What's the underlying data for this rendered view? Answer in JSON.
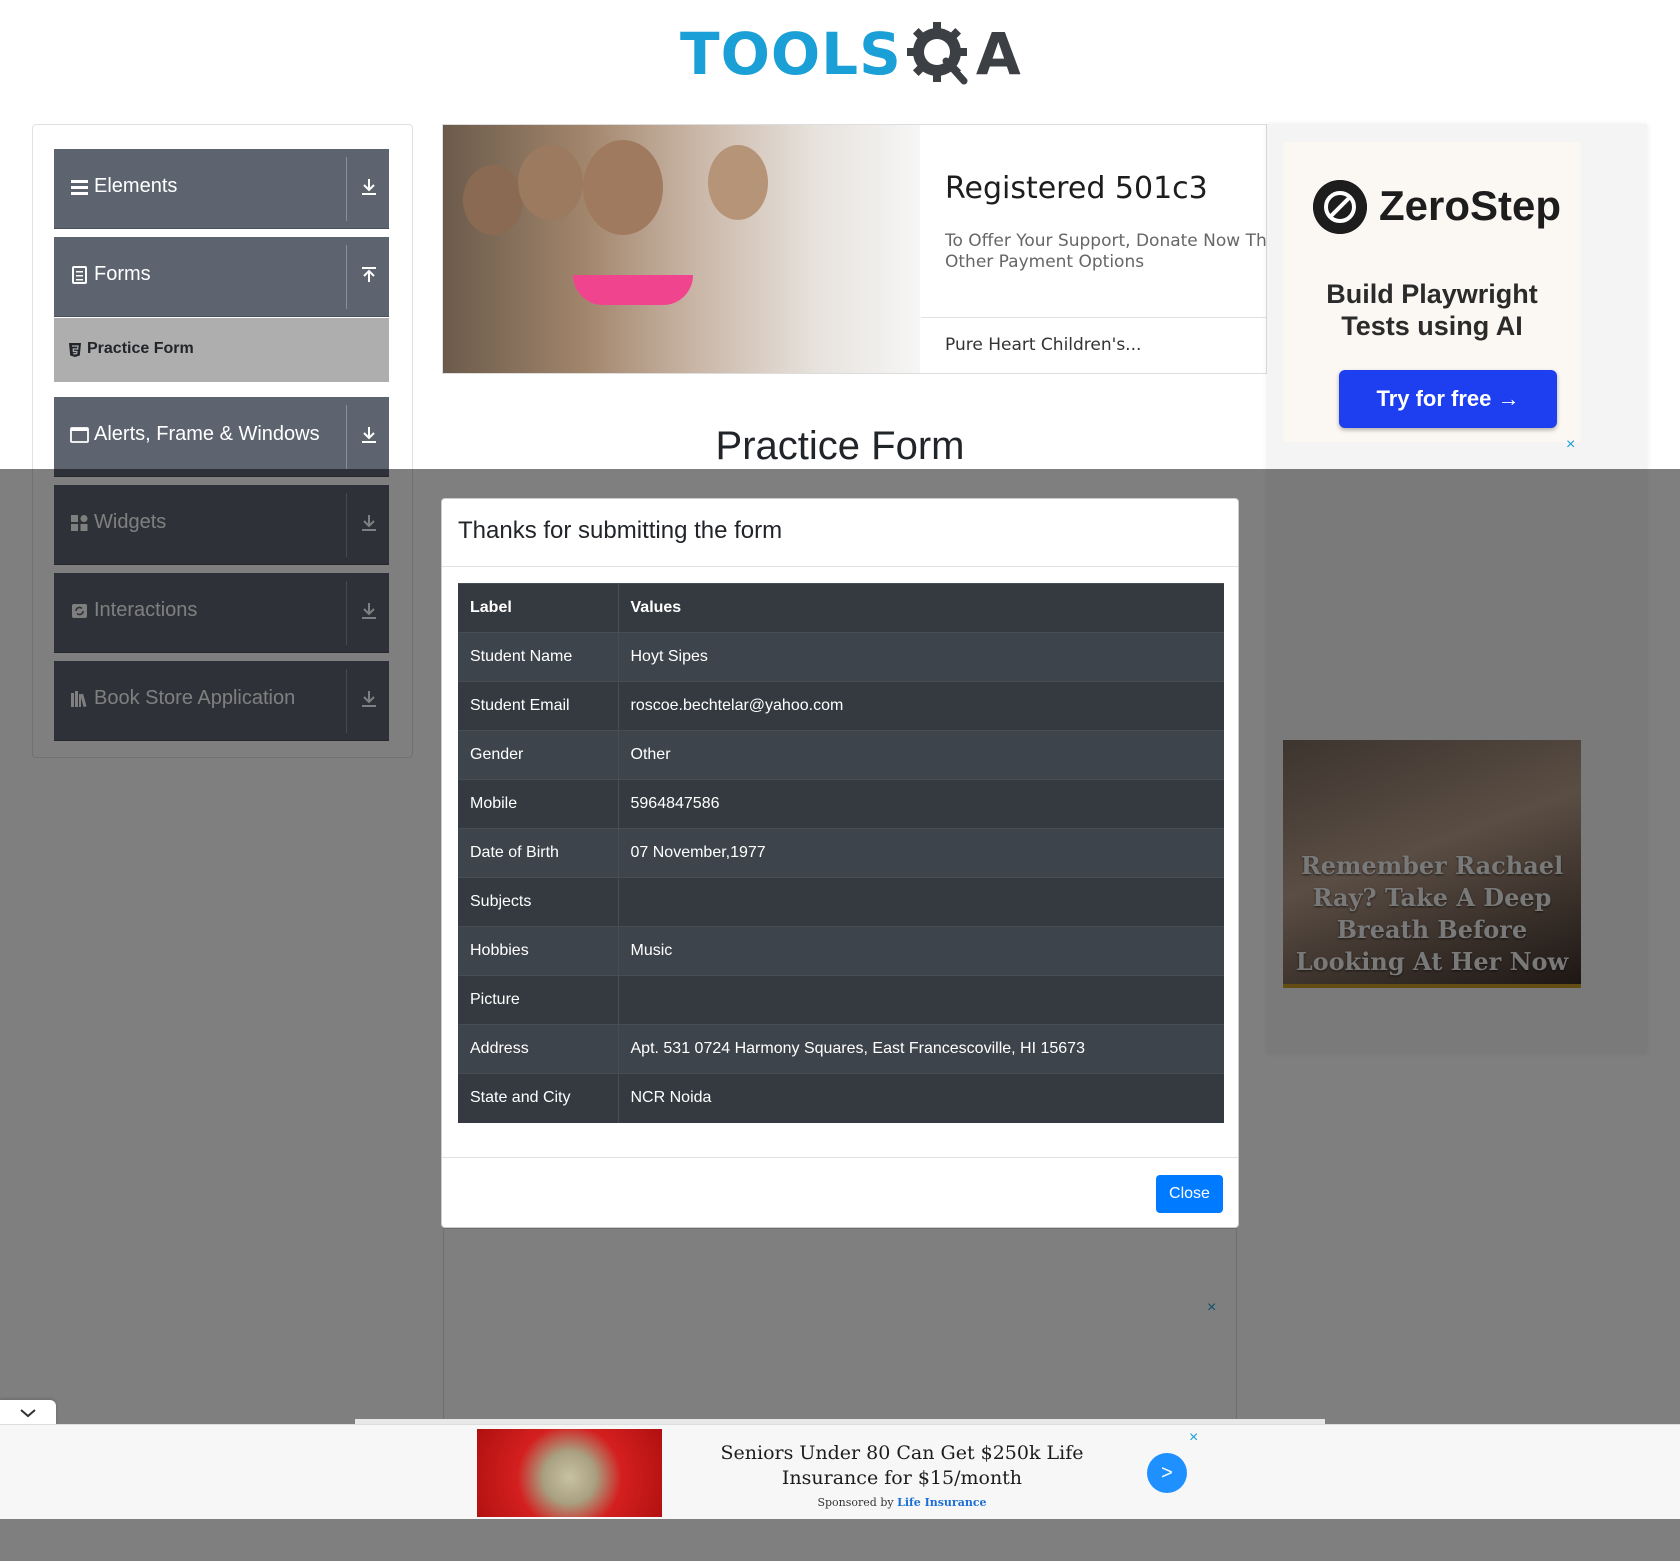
{
  "header": {
    "logo_tools": "TOOLS",
    "logo_a": "A"
  },
  "sidebar": {
    "groups": [
      {
        "label": "Elements",
        "icon": "menu-icon",
        "expanded": false
      },
      {
        "label": "Forms",
        "icon": "form-icon",
        "expanded": true
      },
      {
        "label": "Alerts, Frame & Windows",
        "icon": "window-icon",
        "expanded": false
      },
      {
        "label": "Widgets",
        "icon": "widgets-icon",
        "expanded": false
      },
      {
        "label": "Interactions",
        "icon": "interactions-icon",
        "expanded": false
      },
      {
        "label": "Book Store Application",
        "icon": "books-icon",
        "expanded": false
      }
    ],
    "active_item": "Practice Form"
  },
  "banner_ad": {
    "title": "Registered 501c3",
    "subtitle_line1": "To Offer Your Support, Donate Now Thro",
    "subtitle_line2": "Other Payment Options",
    "footer": "Pure Heart Children's..."
  },
  "page_title": "Practice Form",
  "right_ad": {
    "brand": "ZeroStep",
    "tagline_line1": "Build Playwright",
    "tagline_line2": "Tests using AI",
    "cta": "Try for free →",
    "close": "×",
    "story_headline": "Remember Rachael Ray? Take A Deep Breath Before Looking At Her Now"
  },
  "modal": {
    "title": "Thanks for submitting the form",
    "columns": [
      "Label",
      "Values"
    ],
    "rows": [
      {
        "label": "Student Name",
        "value": "Hoyt Sipes"
      },
      {
        "label": "Student Email",
        "value": "roscoe.bechtelar@yahoo.com"
      },
      {
        "label": "Gender",
        "value": "Other"
      },
      {
        "label": "Mobile",
        "value": "5964847586"
      },
      {
        "label": "Date of Birth",
        "value": "07 November,1977"
      },
      {
        "label": "Subjects",
        "value": ""
      },
      {
        "label": "Hobbies",
        "value": "Music"
      },
      {
        "label": "Picture",
        "value": ""
      },
      {
        "label": "Address",
        "value": "Apt. 531 0724 Harmony Squares, East Francescoville, HI 15673"
      },
      {
        "label": "State and City",
        "value": "NCR Noida"
      }
    ],
    "close_label": "Close"
  },
  "under_ad": {
    "close": "×"
  },
  "bottom_ad": {
    "headline": "Seniors Under 80 Can Get $250k Life Insurance for $15/month",
    "sponsored_prefix": "Sponsored by",
    "sponsor": "Life Insurance",
    "go": ">",
    "close": "×"
  },
  "colors": {
    "accent": "#007bff",
    "sidebar_group": "#5d6470",
    "table_dark": "#343a40",
    "logo_blue": "#1a9fd6"
  }
}
